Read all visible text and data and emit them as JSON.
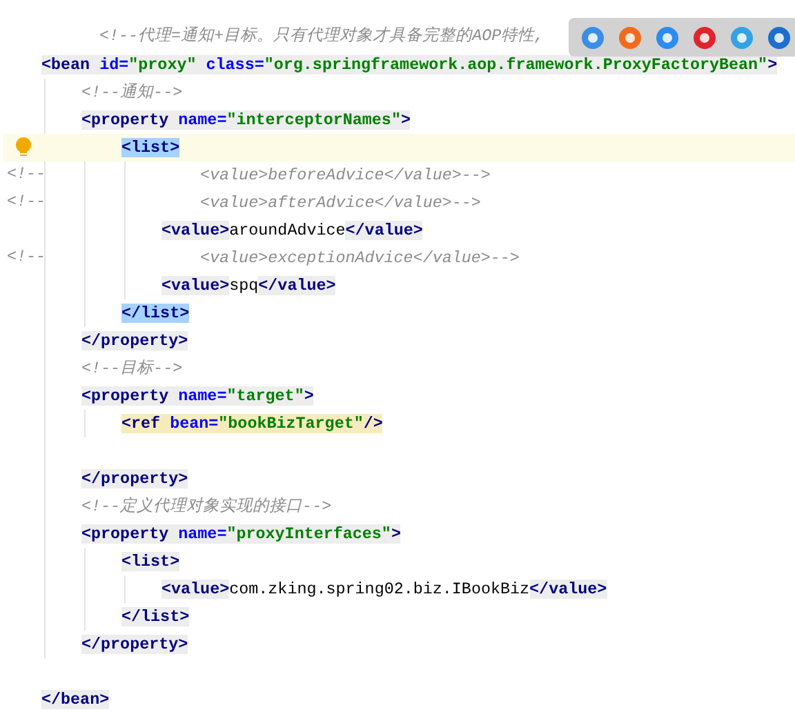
{
  "header_comment": "<!--代理=通知+目标。只有代理对象才具备完整的AOP特性,",
  "lines": [
    {
      "kind": "code",
      "current": false,
      "chunks": [
        {
          "kind": "match",
          "tokens": [
            {
              "kind": "tag",
              "text": "<bean"
            },
            {
              "kind": "attr",
              "text": " id="
            },
            {
              "kind": "string",
              "text": "\"proxy\""
            },
            {
              "kind": "attr",
              "text": " class="
            },
            {
              "kind": "string",
              "text": "\"org.springframework.aop.framework.ProxyFactoryBean\""
            },
            {
              "kind": "tag",
              "text": ">"
            }
          ]
        }
      ],
      "children": [
        {
          "kind": "code",
          "current": false,
          "chunks": [
            {
              "kind": "none",
              "tokens": [
                {
                  "kind": "comment",
                  "text": "<!--通知-->"
                }
              ]
            }
          ]
        },
        {
          "kind": "code",
          "current": false,
          "chunks": [
            {
              "kind": "match",
              "tokens": [
                {
                  "kind": "tag",
                  "text": "<property"
                },
                {
                  "kind": "attr",
                  "text": " name="
                },
                {
                  "kind": "string",
                  "text": "\"interceptorNames\""
                },
                {
                  "kind": "tag",
                  "text": ">"
                }
              ]
            }
          ],
          "children": [
            {
              "kind": "code",
              "current": true,
              "chunks": [
                {
                  "kind": "selected",
                  "tokens": [
                    {
                      "kind": "tag",
                      "text": "<list>"
                    }
                  ]
                }
              ],
              "children": [
                {
                  "kind": "commented",
                  "current": false,
                  "gutter": "<!--",
                  "chunks": [
                    {
                      "kind": "none",
                      "tokens": [
                        {
                          "kind": "comment",
                          "text": "<value>beforeAdvice</value>-->"
                        }
                      ]
                    }
                  ]
                },
                {
                  "kind": "commented",
                  "current": false,
                  "gutter": "<!--",
                  "chunks": [
                    {
                      "kind": "none",
                      "tokens": [
                        {
                          "kind": "comment",
                          "text": "<value>afterAdvice</value>-->"
                        }
                      ]
                    }
                  ]
                },
                {
                  "kind": "code",
                  "current": false,
                  "chunks": [
                    {
                      "kind": "match",
                      "tokens": [
                        {
                          "kind": "tag",
                          "text": "<value>"
                        }
                      ]
                    },
                    {
                      "kind": "none",
                      "tokens": [
                        {
                          "kind": "text",
                          "text": "aroundAdvice"
                        }
                      ]
                    },
                    {
                      "kind": "match",
                      "tokens": [
                        {
                          "kind": "tag",
                          "text": "</value>"
                        }
                      ]
                    }
                  ]
                },
                {
                  "kind": "commented",
                  "current": false,
                  "gutter": "<!--",
                  "chunks": [
                    {
                      "kind": "none",
                      "tokens": [
                        {
                          "kind": "comment",
                          "text": "<value>exceptionAdvice</value>-->"
                        }
                      ]
                    }
                  ]
                },
                {
                  "kind": "code",
                  "current": false,
                  "chunks": [
                    {
                      "kind": "match",
                      "tokens": [
                        {
                          "kind": "tag",
                          "text": "<value>"
                        }
                      ]
                    },
                    {
                      "kind": "none",
                      "tokens": [
                        {
                          "kind": "text",
                          "text": "spq"
                        }
                      ]
                    },
                    {
                      "kind": "match",
                      "tokens": [
                        {
                          "kind": "tag",
                          "text": "</value>"
                        }
                      ]
                    }
                  ]
                }
              ]
            },
            {
              "kind": "code",
              "current": false,
              "chunks": [
                {
                  "kind": "selected",
                  "tokens": [
                    {
                      "kind": "tag",
                      "text": "</list>"
                    }
                  ]
                }
              ]
            }
          ]
        },
        {
          "kind": "code",
          "current": false,
          "chunks": [
            {
              "kind": "match",
              "tokens": [
                {
                  "kind": "tag",
                  "text": "</property>"
                }
              ]
            }
          ]
        },
        {
          "kind": "code",
          "current": false,
          "chunks": [
            {
              "kind": "none",
              "tokens": [
                {
                  "kind": "comment",
                  "text": "<!--目标-->"
                }
              ]
            }
          ]
        },
        {
          "kind": "code",
          "current": false,
          "chunks": [
            {
              "kind": "match",
              "tokens": [
                {
                  "kind": "tag",
                  "text": "<property"
                },
                {
                  "kind": "attr",
                  "text": " name="
                },
                {
                  "kind": "string",
                  "text": "\"target\""
                },
                {
                  "kind": "tag",
                  "text": ">"
                }
              ]
            }
          ],
          "children": [
            {
              "kind": "code",
              "current": false,
              "chunks": [
                {
                  "kind": "ref",
                  "tokens": [
                    {
                      "kind": "tag",
                      "text": "<ref"
                    },
                    {
                      "kind": "attr",
                      "text": " bean="
                    },
                    {
                      "kind": "string",
                      "text": "\"bookBizTarget\""
                    },
                    {
                      "kind": "tag",
                      "text": "/>"
                    }
                  ]
                }
              ]
            }
          ]
        },
        {
          "kind": "blank",
          "current": false
        },
        {
          "kind": "code",
          "current": false,
          "chunks": [
            {
              "kind": "match",
              "tokens": [
                {
                  "kind": "tag",
                  "text": "</property>"
                }
              ]
            }
          ]
        },
        {
          "kind": "code",
          "current": false,
          "chunks": [
            {
              "kind": "none",
              "tokens": [
                {
                  "kind": "comment",
                  "text": "<!--定义代理对象实现的接口-->"
                }
              ]
            }
          ]
        },
        {
          "kind": "code",
          "current": false,
          "chunks": [
            {
              "kind": "match",
              "tokens": [
                {
                  "kind": "tag",
                  "text": "<property"
                },
                {
                  "kind": "attr",
                  "text": " name="
                },
                {
                  "kind": "string",
                  "text": "\"proxyInterfaces\""
                },
                {
                  "kind": "tag",
                  "text": ">"
                }
              ]
            }
          ],
          "children": [
            {
              "kind": "code",
              "current": false,
              "chunks": [
                {
                  "kind": "match",
                  "tokens": [
                    {
                      "kind": "tag",
                      "text": "<list>"
                    }
                  ]
                }
              ],
              "children": [
                {
                  "kind": "code",
                  "current": false,
                  "chunks": [
                    {
                      "kind": "match",
                      "tokens": [
                        {
                          "kind": "tag",
                          "text": "<value>"
                        }
                      ]
                    },
                    {
                      "kind": "none",
                      "tokens": [
                        {
                          "kind": "text",
                          "text": "com.zking.spring02.biz.IBookBiz"
                        }
                      ]
                    },
                    {
                      "kind": "match",
                      "tokens": [
                        {
                          "kind": "tag",
                          "text": "</value>"
                        }
                      ]
                    }
                  ]
                }
              ]
            },
            {
              "kind": "code",
              "current": false,
              "chunks": [
                {
                  "kind": "match",
                  "tokens": [
                    {
                      "kind": "tag",
                      "text": "</list>"
                    }
                  ]
                }
              ]
            }
          ]
        },
        {
          "kind": "code",
          "current": false,
          "chunks": [
            {
              "kind": "match",
              "tokens": [
                {
                  "kind": "tag",
                  "text": "</property>"
                }
              ]
            }
          ]
        }
      ]
    },
    {
      "kind": "blank",
      "current": false
    },
    {
      "kind": "code",
      "current": false,
      "chunks": [
        {
          "kind": "match",
          "tokens": [
            {
              "kind": "tag",
              "text": "</bean>"
            }
          ]
        }
      ]
    }
  ]
}
